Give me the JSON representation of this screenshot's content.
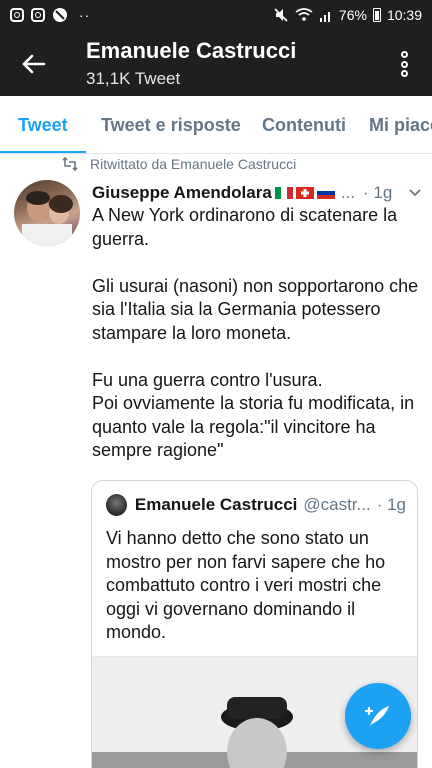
{
  "status_bar": {
    "battery": "76%",
    "time": "10:39",
    "dots": "··",
    "icons": [
      "instagram-icon",
      "instagram-icon",
      "no-sim-icon",
      "mute-icon",
      "wifi-icon",
      "signal-icon",
      "battery-icon"
    ]
  },
  "header": {
    "title": "Emanuele Castrucci",
    "subtitle": "31,1K Tweet",
    "back_icon": "arrow-left-icon",
    "menu_icon": "vertical-dots-icon"
  },
  "tabs": [
    {
      "label": "Tweet",
      "active": true
    },
    {
      "label": "Tweet e risposte",
      "active": false
    },
    {
      "label": "Contenuti",
      "active": false
    },
    {
      "label": "Mi piace",
      "active": false
    }
  ],
  "tweet": {
    "retweet_label": "Ritwittato da Emanuele Castrucci",
    "author_name": "Giuseppe Amendolara",
    "flags": [
      "italy-flag",
      "switzerland-flag",
      "russia-flag"
    ],
    "handle_truncated": "...",
    "time": "· 1g",
    "paragraphs": [
      "A New York ordinarono di scatenare la guerra.",
      "Gli usurai (nasoni) non sopportarono che sia l'Italia sia la Germania potessero stampare la loro moneta.",
      "Fu una guerra contro l'usura.\nPoi ovviamente la storia fu modificata, in quanto vale la regola:\"il vincitore ha sempre ragione\""
    ],
    "quote": {
      "name": "Emanuele Castrucci",
      "handle": "@castr...",
      "time": "· 1g",
      "text": "Vi hanno detto che sono stato un mostro per non farvi sapere che ho combattuto contro i veri mostri che oggi vi governano dominando il mondo."
    }
  },
  "fab": {
    "icon": "compose-tweet-icon"
  },
  "colors": {
    "accent": "#1da1f2",
    "header_bg": "#1f1f1f",
    "muted": "#657786"
  }
}
